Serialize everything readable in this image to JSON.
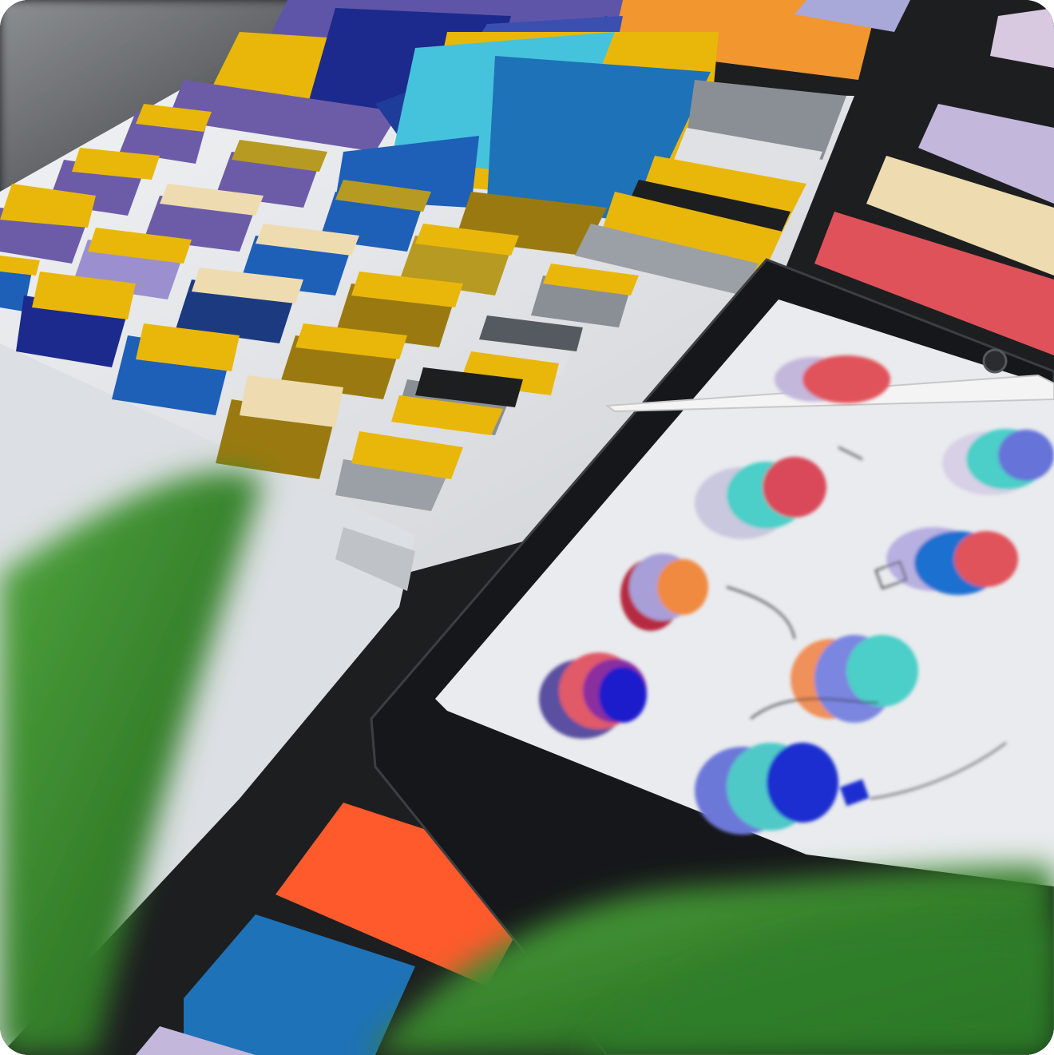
{
  "photo": {
    "subject": "",
    "colors": {
      "desk": "#1d1e20",
      "paper": "#eceef0",
      "yellow": "#e9b70a",
      "navy": "#1b2a8c",
      "royal": "#1e5fb8",
      "cyan": "#45c3dc",
      "lavender": "#b7b0da",
      "purple": "#6c5ca8",
      "olive": "#9a7a10",
      "grey": "#8a8f96",
      "orange": "#f2962f",
      "red": "#e0525a",
      "cream": "#eedcb0",
      "tomato": "#ff5a2c",
      "leaf": "#2f7f2a"
    }
  }
}
